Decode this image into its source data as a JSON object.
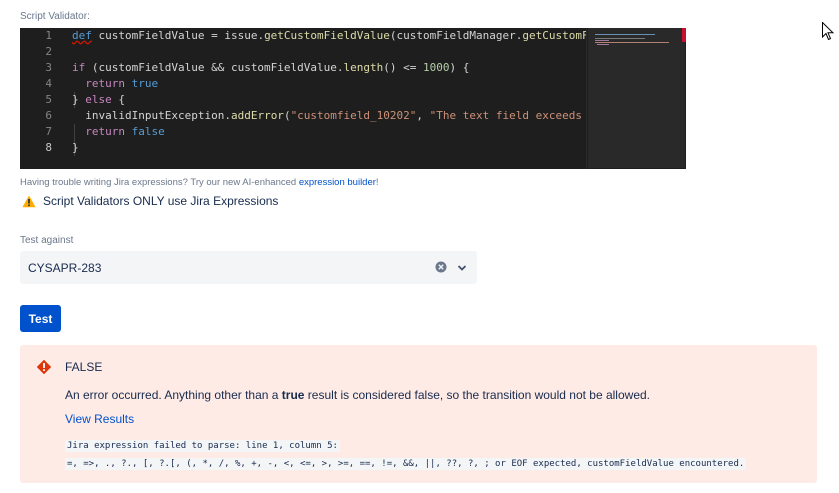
{
  "validator": {
    "label": "Script Validator:",
    "editor": {
      "line_numbers": [
        "1",
        "2",
        "3",
        "4",
        "5",
        "6",
        "7",
        "8"
      ],
      "active_line": "8",
      "lines": [
        [
          {
            "t": "def",
            "c": "kw squiggle"
          },
          {
            "t": " customFieldValue = issue.",
            "c": ""
          },
          {
            "t": "getCustomFieldValue",
            "c": "fn"
          },
          {
            "t": "(customFieldManager.",
            "c": ""
          },
          {
            "t": "getCustomFieldObject",
            "c": "fn"
          },
          {
            "t": "(",
            "c": ""
          }
        ],
        [],
        [
          {
            "t": "if",
            "c": "kw2"
          },
          {
            "t": " (customFieldValue && customFieldValue.",
            "c": ""
          },
          {
            "t": "length",
            "c": "fn"
          },
          {
            "t": "() <= ",
            "c": ""
          },
          {
            "t": "1000",
            "c": "num"
          },
          {
            "t": ") {",
            "c": ""
          }
        ],
        [
          {
            "t": "  ",
            "c": ""
          },
          {
            "t": "return",
            "c": "kw2"
          },
          {
            "t": " ",
            "c": ""
          },
          {
            "t": "true",
            "c": "kw"
          }
        ],
        [
          {
            "t": "} ",
            "c": ""
          },
          {
            "t": "else",
            "c": "kw2"
          },
          {
            "t": " {",
            "c": ""
          }
        ],
        [
          {
            "t": "  invalidInputException.",
            "c": ""
          },
          {
            "t": "addError",
            "c": "fn"
          },
          {
            "t": "(",
            "c": ""
          },
          {
            "t": "\"customfield_10202\"",
            "c": "str"
          },
          {
            "t": ", ",
            "c": ""
          },
          {
            "t": "\"The text field exceeds the",
            "c": "str"
          }
        ],
        [
          {
            "t": "  ",
            "c": ""
          },
          {
            "t": "return",
            "c": "kw2"
          },
          {
            "t": " ",
            "c": ""
          },
          {
            "t": "false",
            "c": "kw"
          }
        ],
        [
          {
            "t": "}",
            "c": ""
          }
        ]
      ]
    },
    "hint_text": "Having trouble writing Jira expressions? Try our new AI-enhanced ",
    "hint_link": "expression builder",
    "hint_suffix": "!",
    "warning": "Script Validators ONLY use Jira Expressions"
  },
  "test": {
    "label": "Test against",
    "selected_issue": "CYSAPR-283",
    "button_label": "Test"
  },
  "result": {
    "status": "FALSE",
    "message_pre": "An error occurred. Anything other than a ",
    "message_bold": "true",
    "message_post": " result is considered false, so the transition would not be allowed.",
    "view_link": "View Results",
    "error_line1": "Jira expression failed to parse: line 1, column 5:",
    "error_line2": "=, =>, ., ?., [, ?.[, (, *, /, %, +, -, <, <=, >, >=, ==, !=, &&, ||, ??, ?, ; or EOF expected, customFieldValue encountered."
  },
  "colors": {
    "primary": "#0052cc",
    "error_bg": "#ffebe6",
    "error_icon": "#de350b",
    "warning_icon": "#ffab00",
    "editor_bg": "#1e1e1e"
  },
  "icons": [
    "warning-icon",
    "clear-icon",
    "chevron-down-icon",
    "error-icon",
    "mouse-cursor-icon"
  ]
}
